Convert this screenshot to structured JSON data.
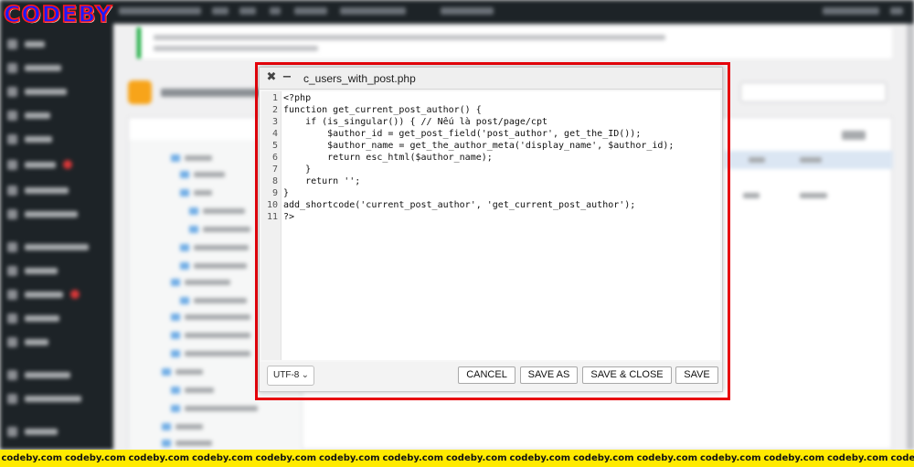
{
  "brand": {
    "text": "CODEBY"
  },
  "editor_dialog": {
    "filename": "c_users_with_post.php",
    "close_symbol": "✖",
    "minimize_symbol": "−",
    "code_lines": [
      "<?php",
      "function get_current_post_author() {",
      "    if (is_singular()) { // Nếu là post/page/cpt",
      "        $author_id = get_post_field('post_author', get_the_ID());",
      "        $author_name = get_the_author_meta('display_name', $author_id);",
      "        return esc_html($author_name);",
      "    }",
      "    return '';",
      "}",
      "add_shortcode('current_post_author', 'get_current_post_author');",
      "?>"
    ],
    "line_numbers": [
      "1",
      "2",
      "3",
      "4",
      "5",
      "6",
      "7",
      "8",
      "9",
      "10",
      "11"
    ],
    "encoding": "UTF-8",
    "buttons": {
      "cancel": "CANCEL",
      "save_as": "SAVE AS",
      "save_close": "SAVE & CLOSE",
      "save": "SAVE"
    }
  },
  "watermark": {
    "items": [
      "codeby.com",
      "codeby.com",
      "codeby.com",
      "codeby.com",
      "codeby.com",
      "codeby.com",
      "codeby.com",
      "codeby.com",
      "codeby.com",
      "codeby.com",
      "codeby.com",
      "codeby.com",
      "codeby.com",
      "codeby.com",
      "codeby.com"
    ]
  },
  "colors": {
    "highlight": "#e8000b",
    "watermark_bg": "#ffea00",
    "admin_dark": "#1d2327"
  }
}
